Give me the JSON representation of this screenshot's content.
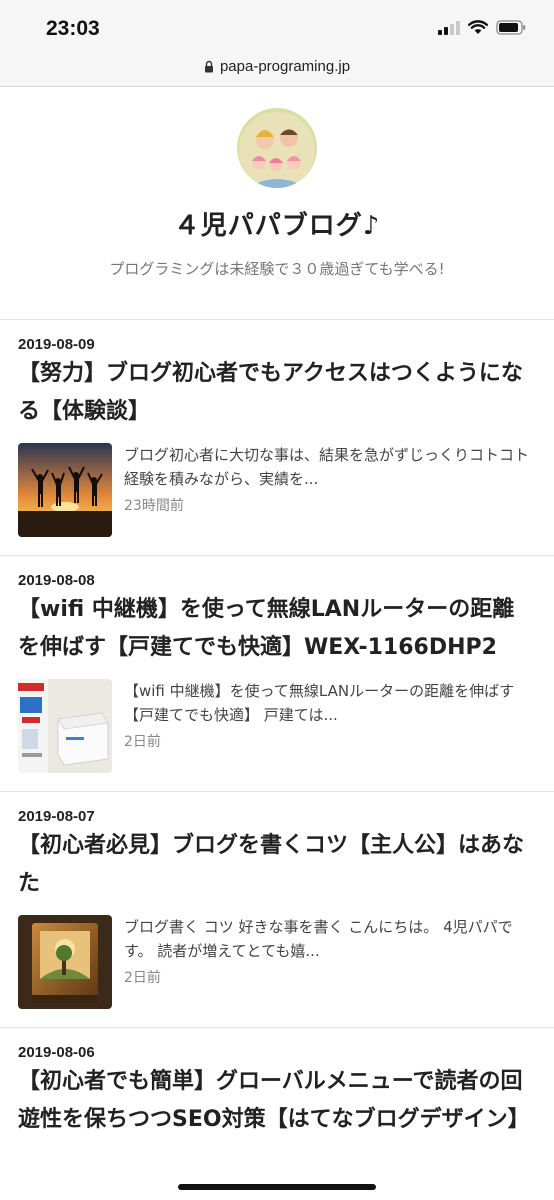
{
  "status": {
    "time": "23:03"
  },
  "browser": {
    "url": "papa-programing.jp"
  },
  "site": {
    "title": "４児パパブログ♪",
    "description": "プログラミングは未経験で３０歳過ぎても学べる!"
  },
  "articles": [
    {
      "date": "2019-08-09",
      "title": "【努力】ブログ初心者でもアクセスはつくようになる【体験談】",
      "excerpt": "ブログ初心者に大切な事は、結果を急がずじっくりコトコト経験を積みながら、実績を...",
      "ago": "23時間前"
    },
    {
      "date": "2019-08-08",
      "title": "【wifi 中継機】を使って無線LANルーターの距離を伸ばす【戸建てでも快適】WEX-1166DHP2",
      "excerpt": "【wifi 中継機】を使って無線LANルーターの距離を伸ばす【戸建てでも快適】 戸建ては...",
      "ago": "2日前"
    },
    {
      "date": "2019-08-07",
      "title": "【初心者必見】ブログを書くコツ【主人公】はあなた",
      "excerpt": "ブログ書く コツ 好きな事を書く こんにちは。 4児パパです。 読者が増えてとても嬉...",
      "ago": "2日前"
    },
    {
      "date": "2019-08-06",
      "title": "【初心者でも簡単】グローバルメニューで読者の回遊性を保ちつつSEO対策【はてなブログデザイン】"
    }
  ]
}
